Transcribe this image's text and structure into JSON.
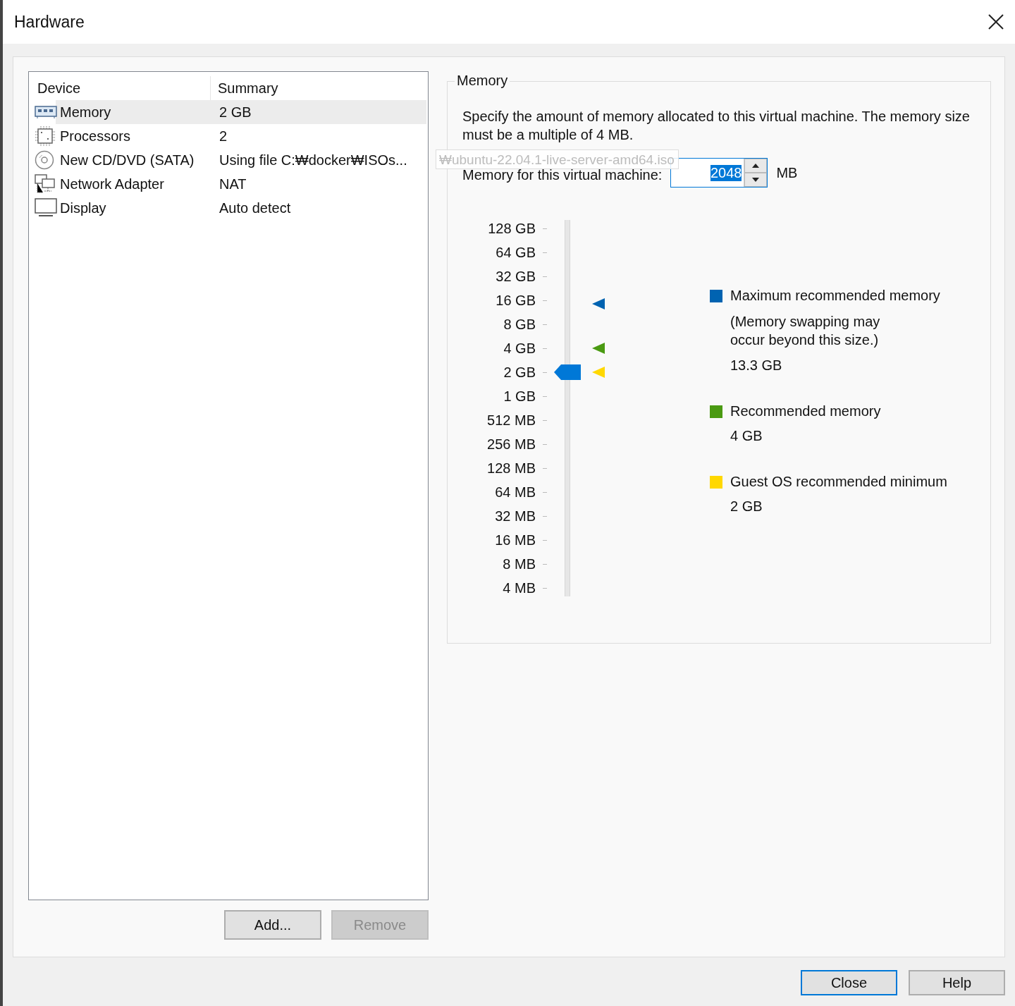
{
  "window": {
    "title": "Hardware"
  },
  "device_table": {
    "columns": [
      "Device",
      "Summary"
    ],
    "rows": [
      {
        "kind": "memory",
        "device": "Memory",
        "summary": "2 GB",
        "selected": true
      },
      {
        "kind": "processor",
        "device": "Processors",
        "summary": "2",
        "selected": false
      },
      {
        "kind": "disc",
        "device": "New CD/DVD (SATA)",
        "summary": "Using file C:₩docker₩ISOs...",
        "selected": false
      },
      {
        "kind": "network",
        "device": "Network Adapter",
        "summary": "NAT",
        "selected": false
      },
      {
        "kind": "display",
        "device": "Display",
        "summary": "Auto detect",
        "selected": false
      }
    ]
  },
  "tooltip": {
    "text": "₩ubuntu-22.04.1-live-server-amd64.iso"
  },
  "list_buttons": [
    {
      "label": "Add...",
      "disabled": false
    },
    {
      "label": "Remove",
      "disabled": true
    }
  ],
  "memory": {
    "title": "Memory",
    "description": "Specify the amount of memory allocated to this virtual machine. The memory size must be a multiple of 4 MB.",
    "field_label": "Memory for this virtual machine:",
    "value": "2048",
    "unit": "MB",
    "scale_labels": [
      "128 GB",
      "64 GB",
      "32 GB",
      "16 GB",
      "8 GB",
      "4 GB",
      "2 GB",
      "1 GB",
      "512 MB",
      "256 MB",
      "128 MB",
      "64 MB",
      "32 MB",
      "16 MB",
      "8 MB",
      "4 MB"
    ],
    "level": 0.6,
    "legend": [
      {
        "label": "Maximum recommended memory",
        "note": "(Memory swapping may occur beyond this size.)",
        "value": "13.3 GB",
        "color": "#0063b1"
      },
      {
        "label": "Recommended memory",
        "value": "4 GB",
        "color": "#4a9a12"
      },
      {
        "label": "Guest OS recommended minimum",
        "value": "2 GB",
        "color": "#ffd800"
      }
    ],
    "scale_markers": [
      {
        "color": "#0063b1",
        "level": 0.79
      },
      {
        "color": "#4a9a12",
        "level": 0.667
      },
      {
        "color": "#ffd800",
        "level": 0.6
      }
    ]
  },
  "buttons": [
    {
      "label": "Close",
      "default": true
    },
    {
      "label": "Help",
      "default": false
    }
  ]
}
